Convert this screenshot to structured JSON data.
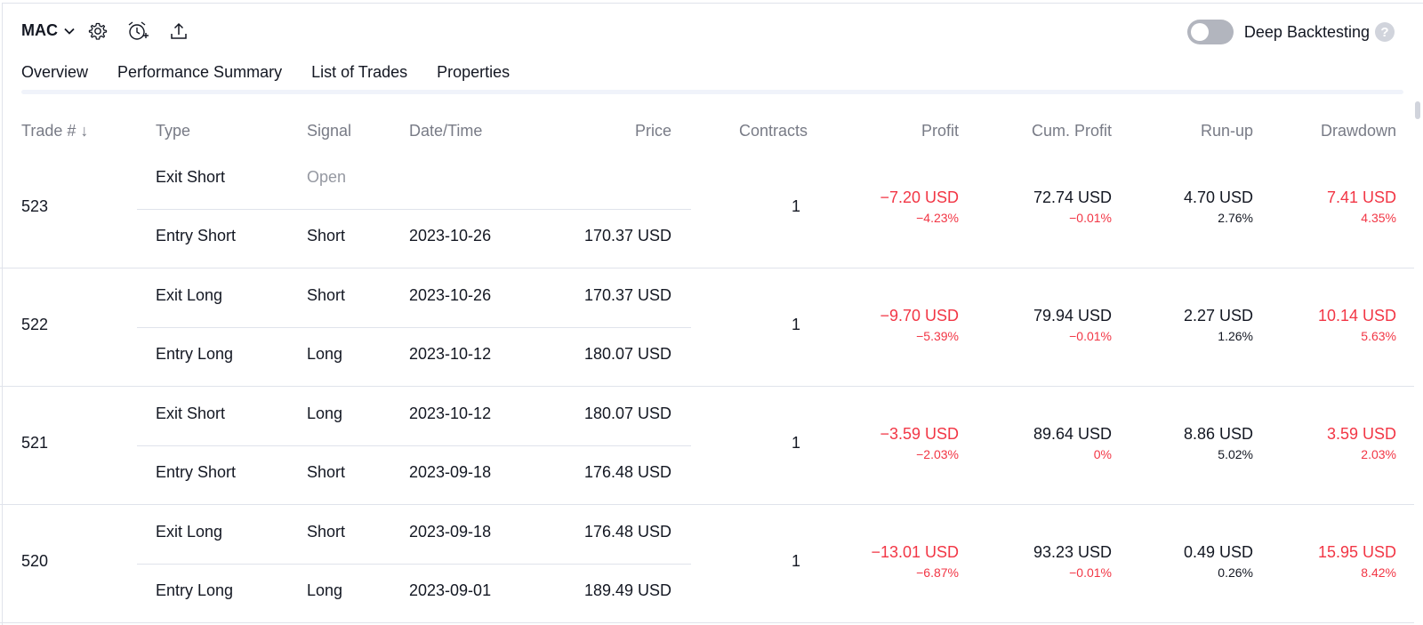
{
  "toolbar": {
    "symbol": "MAC",
    "settings_icon": "gear-icon",
    "alert_icon": "alarm-clock-plus-icon",
    "export_icon": "upload-icon",
    "deep_backtesting_label": "Deep Backtesting",
    "deep_backtesting_on": false,
    "help_glyph": "?"
  },
  "tabs": [
    {
      "label": "Overview",
      "active": false
    },
    {
      "label": "Performance Summary",
      "active": false
    },
    {
      "label": "List of Trades",
      "active": true
    },
    {
      "label": "Properties",
      "active": false
    }
  ],
  "columns": {
    "trade": "Trade #",
    "sort_glyph": "↓",
    "type": "Type",
    "signal": "Signal",
    "datetime": "Date/Time",
    "price": "Price",
    "contracts": "Contracts",
    "profit": "Profit",
    "cum_profit": "Cum. Profit",
    "runup": "Run-up",
    "drawdown": "Drawdown"
  },
  "trades": [
    {
      "number": "523",
      "exit": {
        "type": "Exit Short",
        "signal": "Open",
        "datetime": "",
        "price": ""
      },
      "entry": {
        "type": "Entry Short",
        "signal": "Short",
        "datetime": "2023-10-26",
        "price": "170.37 USD"
      },
      "contracts": "1",
      "profit": "−7.20 USD",
      "profit_pct": "−4.23%",
      "cum_profit": "72.74 USD",
      "cum_profit_pct": "−0.01%",
      "runup": "4.70 USD",
      "runup_pct": "2.76%",
      "drawdown": "7.41 USD",
      "drawdown_pct": "4.35%"
    },
    {
      "number": "522",
      "exit": {
        "type": "Exit Long",
        "signal": "Short",
        "datetime": "2023-10-26",
        "price": "170.37 USD"
      },
      "entry": {
        "type": "Entry Long",
        "signal": "Long",
        "datetime": "2023-10-12",
        "price": "180.07 USD"
      },
      "contracts": "1",
      "profit": "−9.70 USD",
      "profit_pct": "−5.39%",
      "cum_profit": "79.94 USD",
      "cum_profit_pct": "−0.01%",
      "runup": "2.27 USD",
      "runup_pct": "1.26%",
      "drawdown": "10.14 USD",
      "drawdown_pct": "5.63%"
    },
    {
      "number": "521",
      "exit": {
        "type": "Exit Short",
        "signal": "Long",
        "datetime": "2023-10-12",
        "price": "180.07 USD"
      },
      "entry": {
        "type": "Entry Short",
        "signal": "Short",
        "datetime": "2023-09-18",
        "price": "176.48 USD"
      },
      "contracts": "1",
      "profit": "−3.59 USD",
      "profit_pct": "−2.03%",
      "cum_profit": "89.64 USD",
      "cum_profit_pct": "0%",
      "runup": "8.86 USD",
      "runup_pct": "5.02%",
      "drawdown": "3.59 USD",
      "drawdown_pct": "2.03%"
    },
    {
      "number": "520",
      "exit": {
        "type": "Exit Long",
        "signal": "Short",
        "datetime": "2023-09-18",
        "price": "176.48 USD"
      },
      "entry": {
        "type": "Entry Long",
        "signal": "Long",
        "datetime": "2023-09-01",
        "price": "189.49 USD"
      },
      "contracts": "1",
      "profit": "−13.01 USD",
      "profit_pct": "−6.87%",
      "cum_profit": "93.23 USD",
      "cum_profit_pct": "−0.01%",
      "runup": "0.49 USD",
      "runup_pct": "0.26%",
      "drawdown": "15.95 USD",
      "drawdown_pct": "8.42%"
    }
  ],
  "colors": {
    "negative": "#f23645",
    "text": "#131722",
    "muted": "#787b86",
    "border": "#e0e3eb"
  }
}
